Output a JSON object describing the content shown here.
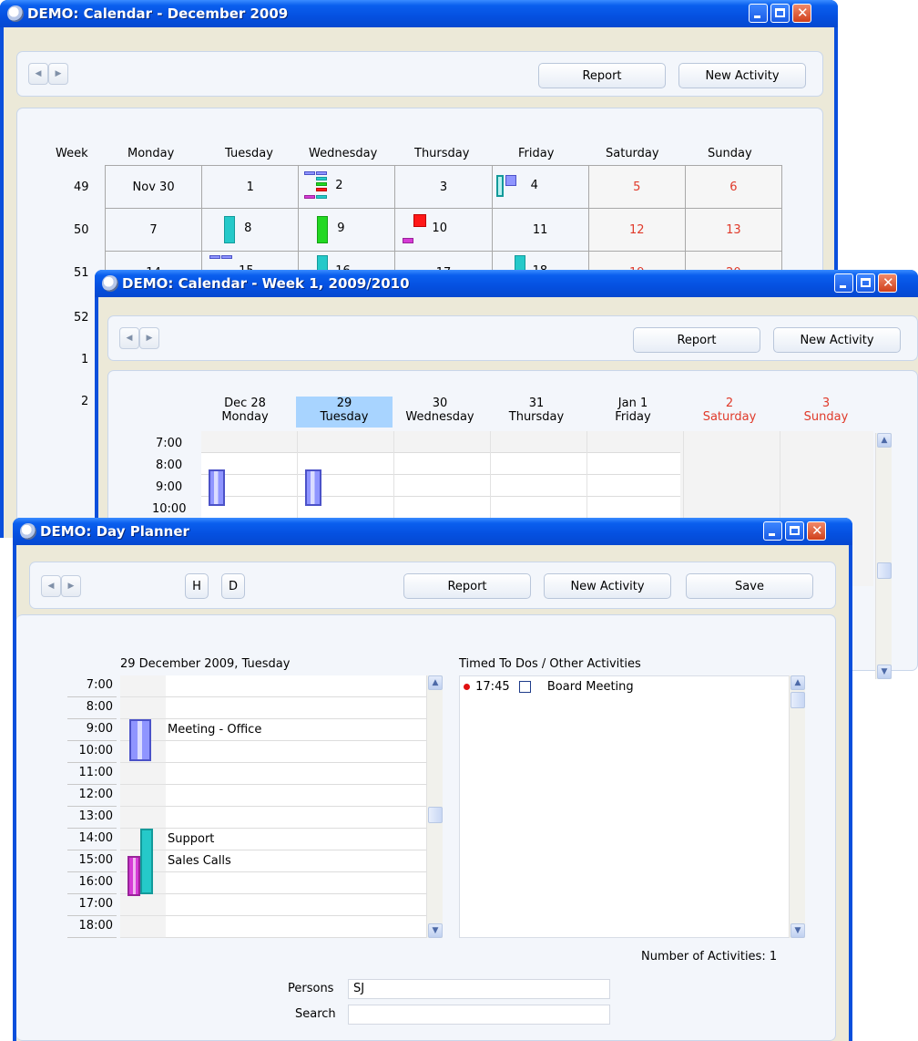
{
  "month_window": {
    "title": "DEMO: Calendar - December 2009",
    "report_label": "Report",
    "new_activity_label": "New Activity",
    "headers": [
      "Week",
      "Monday",
      "Tuesday",
      "Wednesday",
      "Thursday",
      "Friday",
      "Saturday",
      "Sunday"
    ],
    "rows": [
      {
        "week": "49",
        "days": [
          "Nov 30",
          "1",
          "2",
          "3",
          "4",
          "5",
          "6"
        ]
      },
      {
        "week": "50",
        "days": [
          "7",
          "8",
          "9",
          "10",
          "11",
          "12",
          "13"
        ]
      },
      {
        "week": "51",
        "days": [
          "14",
          "15",
          "16",
          "17",
          "18",
          "19",
          "20"
        ]
      },
      {
        "week": "52",
        "days": []
      },
      {
        "week": "1",
        "days": []
      },
      {
        "week": "2",
        "days": []
      }
    ]
  },
  "week_window": {
    "title": "DEMO: Calendar - Week 1, 2009/2010",
    "report_label": "Report",
    "new_activity_label": "New Activity",
    "days": [
      {
        "date": "Dec 28",
        "name": "Monday"
      },
      {
        "date": "29",
        "name": "Tuesday"
      },
      {
        "date": "30",
        "name": "Wednesday"
      },
      {
        "date": "31",
        "name": "Thursday"
      },
      {
        "date": "Jan 1",
        "name": "Friday"
      },
      {
        "date": "2",
        "name": "Saturday"
      },
      {
        "date": "3",
        "name": "Sunday"
      }
    ],
    "times": [
      "7:00",
      "8:00",
      "9:00",
      "10:00"
    ]
  },
  "day_window": {
    "title": "DEMO: Day Planner",
    "h_label": "H",
    "d_label": "D",
    "report_label": "Report",
    "new_activity_label": "New Activity",
    "save_label": "Save",
    "date_heading": "29 December 2009, Tuesday",
    "times": [
      "7:00",
      "8:00",
      "9:00",
      "10:00",
      "11:00",
      "12:00",
      "13:00",
      "14:00",
      "15:00",
      "16:00",
      "17:00",
      "18:00"
    ],
    "activity_labels": {
      "9:00": "Meeting - Office",
      "14:00": "Support",
      "15:00": "Sales Calls"
    },
    "todos_heading": "Timed To Dos / Other Activities",
    "todo": {
      "time": "17:45",
      "text": "Board Meeting"
    },
    "count_text": "Number of Activities: 1",
    "persons_label": "Persons",
    "persons_value": "SJ",
    "search_label": "Search",
    "search_value": ""
  },
  "colors": {
    "titlebar": "#0a5fee",
    "weekend_text": "#e03a2a",
    "highlight_day": "#a8d4ff",
    "activity_blue": "#8f95ff",
    "activity_teal": "#25c9c9",
    "activity_green": "#22d822",
    "activity_red": "#ff1818",
    "activity_magenta": "#d63bd6"
  }
}
